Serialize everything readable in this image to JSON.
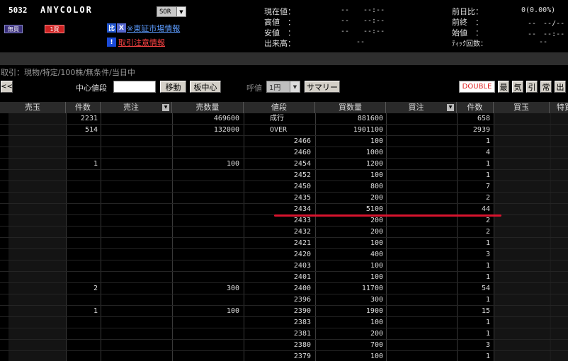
{
  "header": {
    "code": "5032",
    "name": "ANYCOLOR",
    "market_select": "SOR",
    "btn_mugai": "無買",
    "btn_ichi": "1買",
    "icon_hi": "比",
    "icon_x": "X",
    "icon_ex": "!",
    "market_info": "※東証市場情報",
    "caution_info": "取引注意情報",
    "quotes_left": [
      {
        "label": "現在値：",
        "value": "--",
        "time": "--:--"
      },
      {
        "label": "高値　：",
        "value": "--",
        "time": "--:--"
      },
      {
        "label": "安値　：",
        "value": "--",
        "time": "--:--"
      },
      {
        "label": "出来高：",
        "value": "--",
        "time": ""
      }
    ],
    "quotes_right": [
      {
        "label": "前日比：",
        "value": "0(0.00%)"
      },
      {
        "label": "前終　：",
        "value": "--　--/--"
      },
      {
        "label": "始値　：",
        "value": "--　--:--"
      },
      {
        "label": "ﾃｨｯｸ回数：",
        "value": "--"
      }
    ]
  },
  "condition_text": "取引：現物/特定/100株/無条件/当日中",
  "toolbar": {
    "back": "<<",
    "center_label": "中心値段",
    "center_value": "",
    "move": "移動",
    "board_center": "板中心",
    "yobine_label": "呼値",
    "yobine_value": "1円",
    "summary": "サマリー",
    "double": "DOUBLE",
    "k1": "最",
    "k2": "気",
    "k3": "引",
    "k4": "常",
    "k5": "出"
  },
  "columns": [
    "売玉",
    "件数",
    "売注",
    "売数量",
    "値段",
    "買数量",
    "買注",
    "件数",
    "買玉",
    "特買"
  ],
  "rows": [
    {
      "sell_count": "2231",
      "sell_qty": "469600",
      "price": "成行",
      "buy_qty": "881600",
      "buy_count": "658"
    },
    {
      "sell_count": "514",
      "sell_qty": "132000",
      "price": "OVER",
      "buy_qty": "1901100",
      "buy_count": "2939"
    },
    {
      "sell_count": "",
      "sell_qty": "",
      "price": "2466",
      "buy_qty": "100",
      "buy_count": "1"
    },
    {
      "sell_count": "",
      "sell_qty": "",
      "price": "2460",
      "buy_qty": "1000",
      "buy_count": "4"
    },
    {
      "sell_count": "1",
      "sell_qty": "100",
      "price": "2454",
      "buy_qty": "1200",
      "buy_count": "1"
    },
    {
      "sell_count": "",
      "sell_qty": "",
      "price": "2452",
      "buy_qty": "100",
      "buy_count": "1"
    },
    {
      "sell_count": "",
      "sell_qty": "",
      "price": "2450",
      "buy_qty": "800",
      "buy_count": "7"
    },
    {
      "sell_count": "",
      "sell_qty": "",
      "price": "2435",
      "buy_qty": "200",
      "buy_count": "2"
    },
    {
      "sell_count": "",
      "sell_qty": "",
      "price": "2434",
      "buy_qty": "5100",
      "buy_count": "44"
    },
    {
      "sell_count": "",
      "sell_qty": "",
      "price": "2433",
      "buy_qty": "200",
      "buy_count": "2"
    },
    {
      "sell_count": "",
      "sell_qty": "",
      "price": "2432",
      "buy_qty": "200",
      "buy_count": "2"
    },
    {
      "sell_count": "",
      "sell_qty": "",
      "price": "2421",
      "buy_qty": "100",
      "buy_count": "1"
    },
    {
      "sell_count": "",
      "sell_qty": "",
      "price": "2420",
      "buy_qty": "400",
      "buy_count": "3"
    },
    {
      "sell_count": "",
      "sell_qty": "",
      "price": "2403",
      "buy_qty": "100",
      "buy_count": "1"
    },
    {
      "sell_count": "",
      "sell_qty": "",
      "price": "2401",
      "buy_qty": "100",
      "buy_count": "1"
    },
    {
      "sell_count": "2",
      "sell_qty": "300",
      "price": "2400",
      "buy_qty": "11700",
      "buy_count": "54"
    },
    {
      "sell_count": "",
      "sell_qty": "",
      "price": "2396",
      "buy_qty": "300",
      "buy_count": "1"
    },
    {
      "sell_count": "1",
      "sell_qty": "100",
      "price": "2390",
      "buy_qty": "1900",
      "buy_count": "15"
    },
    {
      "sell_count": "",
      "sell_qty": "",
      "price": "2383",
      "buy_qty": "100",
      "buy_count": "1"
    },
    {
      "sell_count": "",
      "sell_qty": "",
      "price": "2381",
      "buy_qty": "200",
      "buy_count": "1"
    },
    {
      "sell_count": "",
      "sell_qty": "",
      "price": "2380",
      "buy_qty": "700",
      "buy_count": "3"
    },
    {
      "sell_count": "",
      "sell_qty": "",
      "price": "2379",
      "buy_qty": "100",
      "buy_count": "1"
    }
  ]
}
